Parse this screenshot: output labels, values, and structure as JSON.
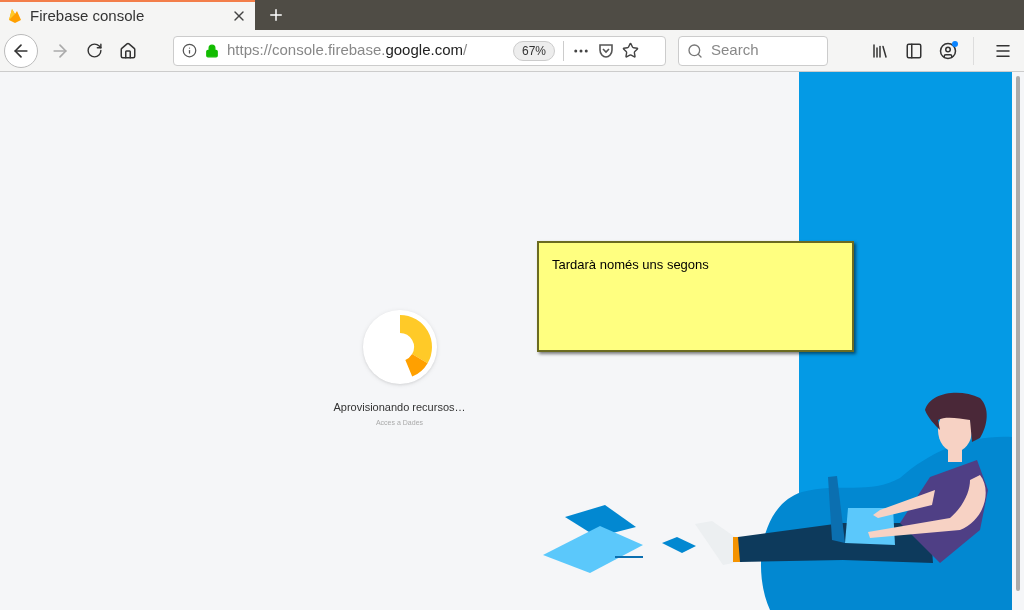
{
  "browser": {
    "tab": {
      "title": "Firebase console",
      "selected": true
    },
    "url": {
      "scheme_and_subdomain": "https://console.firebase.",
      "domain": "google.com",
      "path": "/"
    },
    "zoom": "67%",
    "search": {
      "placeholder": "Search"
    }
  },
  "loader": {
    "title": "Aprovisionando recursos…",
    "subtitle": "Acces a Dades"
  },
  "sticky_note": {
    "text": "Tardarà només uns segons"
  }
}
